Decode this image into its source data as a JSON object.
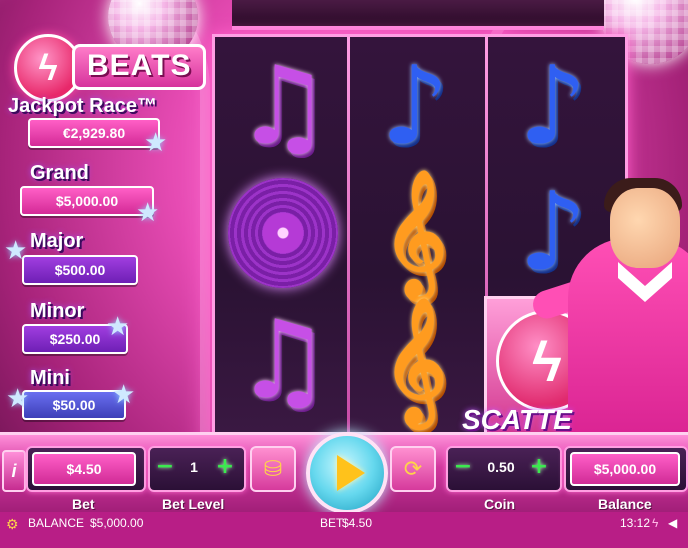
{
  "logo": {
    "icon": "lightning-icon",
    "text": "BEATS"
  },
  "jackpots": {
    "race": {
      "title": "Jackpot Race™",
      "value": "€2,929.80"
    },
    "grand": {
      "title": "Grand",
      "value": "$5,000.00"
    },
    "major": {
      "title": "Major",
      "value": "$500.00"
    },
    "minor": {
      "title": "Minor",
      "value": "$250.00"
    },
    "mini": {
      "title": "Mini",
      "value": "$50.00"
    }
  },
  "reels": [
    [
      "purple-note",
      "vinyl-record",
      "purple-note"
    ],
    [
      "blue-note",
      "orange-treble-clef",
      "orange-treble-clef"
    ],
    [
      "blue-note",
      "blue-note",
      "scatter"
    ]
  ],
  "scatter_label": "SCATTE",
  "controls": {
    "info_label": "i",
    "bet": {
      "value": "$4.50",
      "label": "Bet"
    },
    "bet_level": {
      "value": "1",
      "label": "Bet Level",
      "minus": "−",
      "plus": "+"
    },
    "coin": {
      "value": "0.50",
      "label": "Coin",
      "minus": "−",
      "plus": "+"
    },
    "balance": {
      "value": "$5,000.00",
      "label": "Balance"
    }
  },
  "status_bar": {
    "balance_label": "BALANCE",
    "balance_value": "$5,000.00",
    "bet_label": "BET",
    "bet_value": "$4.50",
    "time": "13:12"
  },
  "colors": {
    "accent_pink": "#e64bb3",
    "spin_yellow": "#ffc21b",
    "plus_minus_green": "#3bea4f"
  }
}
